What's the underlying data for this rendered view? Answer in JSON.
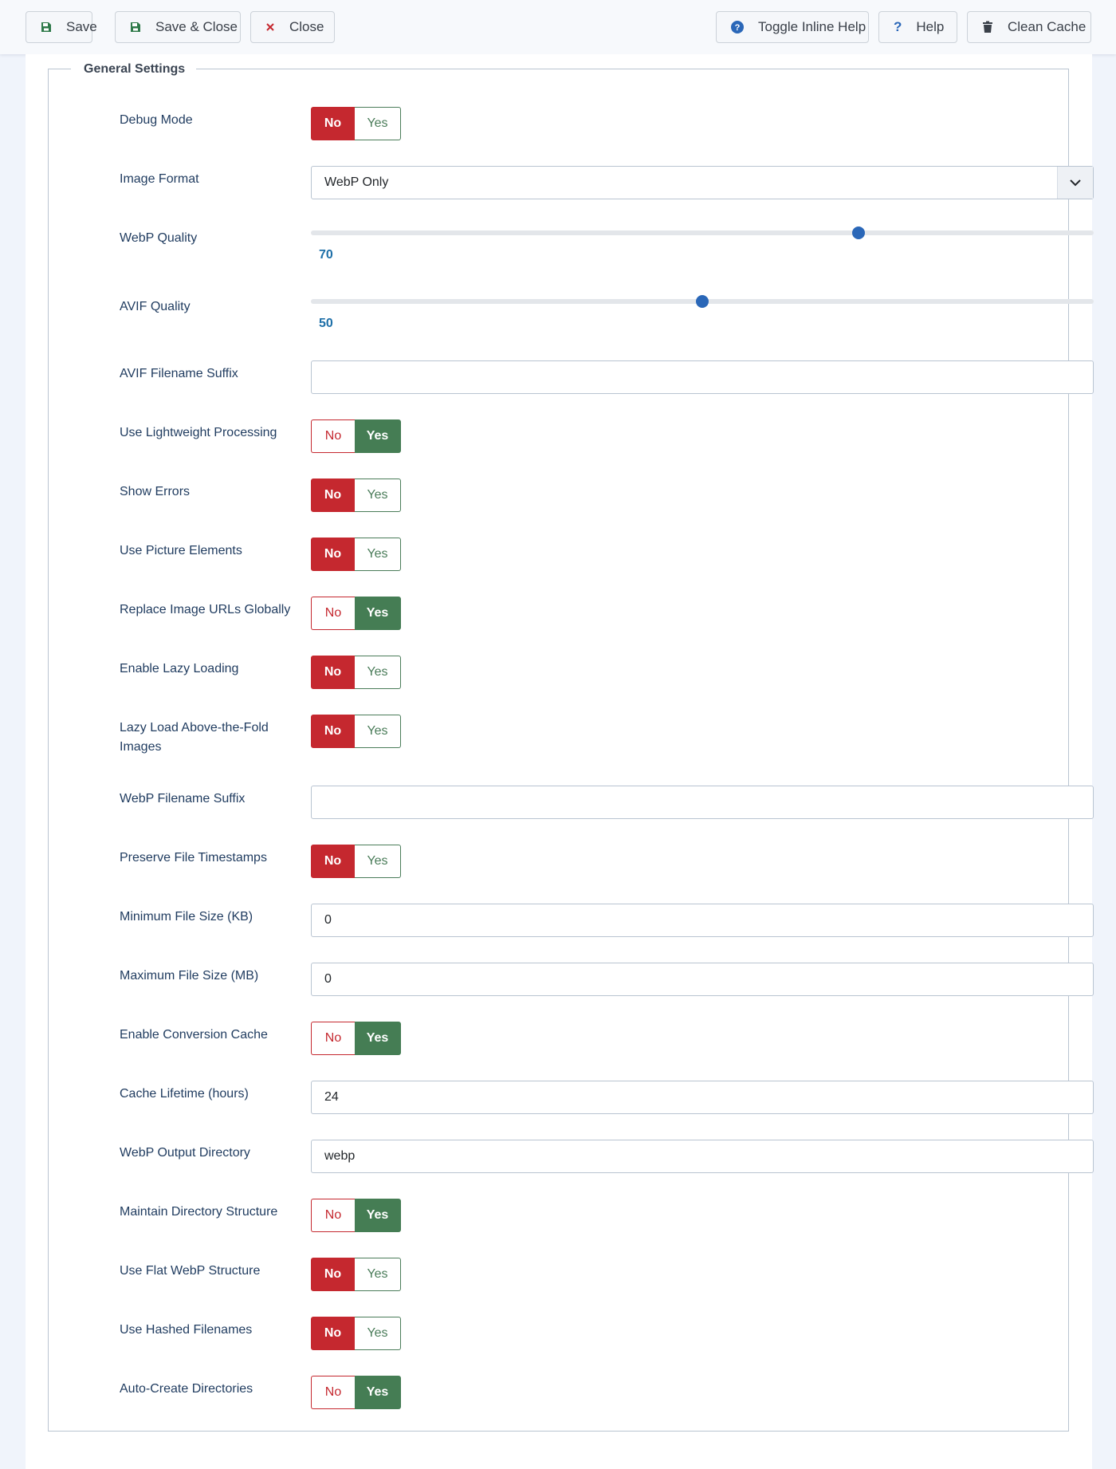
{
  "toolbar": {
    "save": "Save",
    "save_close": "Save & Close",
    "close": "Close",
    "toggle_help": "Toggle Inline Help",
    "help": "Help",
    "clean_cache": "Clean Cache"
  },
  "fieldset": {
    "legend": "General Settings"
  },
  "toggle_options": {
    "no": "No",
    "yes": "Yes"
  },
  "fields": {
    "debug_mode": {
      "label": "Debug Mode",
      "value": "No"
    },
    "image_format": {
      "label": "Image Format",
      "value": "WebP Only"
    },
    "webp_quality": {
      "label": "WebP Quality",
      "value": 70,
      "min": 0,
      "max": 100
    },
    "avif_quality": {
      "label": "AVIF Quality",
      "value": 50,
      "min": 0,
      "max": 100
    },
    "avif_suffix": {
      "label": "AVIF Filename Suffix",
      "value": ""
    },
    "lightweight": {
      "label": "Use Lightweight Processing",
      "value": "Yes"
    },
    "show_errors": {
      "label": "Show Errors",
      "value": "No"
    },
    "picture_elements": {
      "label": "Use Picture Elements",
      "value": "No"
    },
    "replace_urls": {
      "label": "Replace Image URLs Globally",
      "value": "Yes"
    },
    "lazy_loading": {
      "label": "Enable Lazy Loading",
      "value": "No"
    },
    "lazy_above_fold": {
      "label": "Lazy Load Above-the-Fold Images",
      "value": "No"
    },
    "webp_suffix": {
      "label": "WebP Filename Suffix",
      "value": ""
    },
    "preserve_timestamps": {
      "label": "Preserve File Timestamps",
      "value": "No"
    },
    "min_size": {
      "label": "Minimum File Size (KB)",
      "value": "0"
    },
    "max_size": {
      "label": "Maximum File Size (MB)",
      "value": "0"
    },
    "conversion_cache": {
      "label": "Enable Conversion Cache",
      "value": "Yes"
    },
    "cache_lifetime": {
      "label": "Cache Lifetime (hours)",
      "value": "24"
    },
    "output_dir": {
      "label": "WebP Output Directory",
      "value": "webp"
    },
    "maintain_structure": {
      "label": "Maintain Directory Structure",
      "value": "Yes"
    },
    "flat_structure": {
      "label": "Use Flat WebP Structure",
      "value": "No"
    },
    "hashed_filenames": {
      "label": "Use Hashed Filenames",
      "value": "No"
    },
    "auto_create": {
      "label": "Auto-Create Directories",
      "value": "Yes"
    }
  },
  "colors": {
    "no_active": "#c5282f",
    "yes_active": "#457d54",
    "slider_value": "#1d6fa8",
    "slider_thumb": "#2a67b8"
  }
}
